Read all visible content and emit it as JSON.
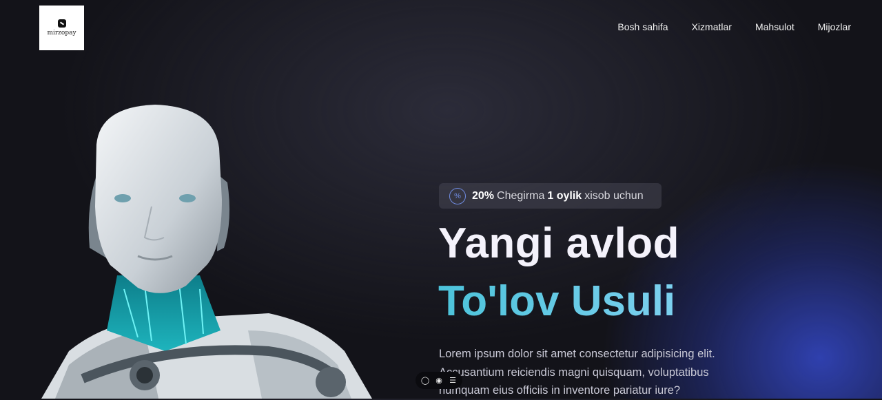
{
  "logo": {
    "text": "mirzopay"
  },
  "nav": {
    "items": [
      "Bosh sahifa",
      "Xizmatlar",
      "Mahsulot",
      "Mijozlar"
    ]
  },
  "badge": {
    "percent": "20%",
    "text1": "Chegirma",
    "duration": "1 oylik",
    "text2": "xisob uchun"
  },
  "hero": {
    "title_line1": "Yangi avlod",
    "title_line2": "To'lov Usuli",
    "description": "Lorem ipsum dolor sit amet consectetur adipisicing elit. Accusantium reiciendis magni quisquam, voluptatibus numquam eius officiis in inventore pariatur iure?"
  },
  "toolbar": {
    "icons": [
      "comment-icon",
      "eye-icon",
      "menu-icon"
    ]
  },
  "colors": {
    "accent_gradient_start": "#4cc3da",
    "accent_gradient_end": "#7cd0ef",
    "badge_ring": "#6f8be0",
    "background": "#131319"
  }
}
